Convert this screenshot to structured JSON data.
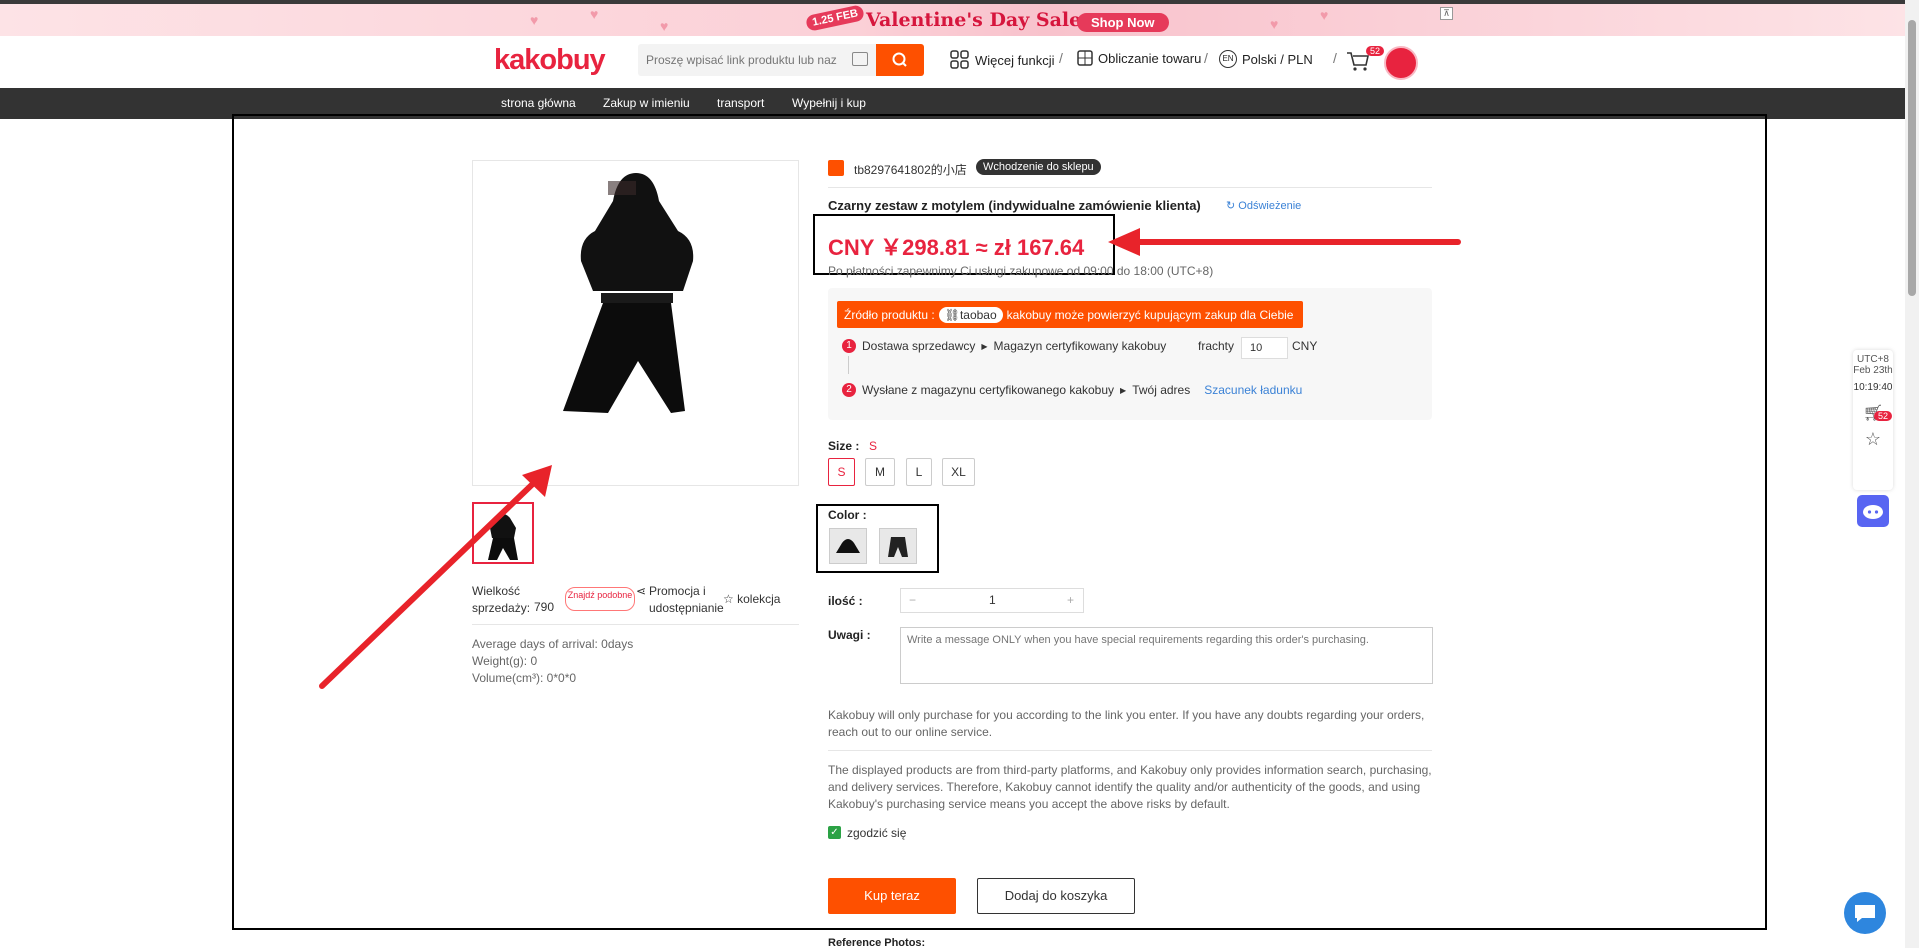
{
  "banner": {
    "date": "1.25 FEB",
    "title": "Valentine's Day Sale",
    "shop_now": "Shop Now"
  },
  "header": {
    "logo": "kakobuy",
    "search_placeholder": "Proszę wpisać link produktu lub naz",
    "more_functions": "Więcej funkcji",
    "calc": "Obliczanie towaru",
    "lang_badge": "EN",
    "lang": "Polski / PLN",
    "cart_count": "52"
  },
  "nav": {
    "items": [
      "strona główna",
      "Zakup w imieniu",
      "transport",
      "Wypełnij i kup"
    ]
  },
  "product": {
    "store_name": "tb8297641802的小店",
    "enter_store": "Wchodzenie do sklepu",
    "title": "Czarny zestaw z motylem (indywidualne zamówienie klienta)",
    "refresh": "Odświeżenie",
    "price": "CNY ￥298.81 ≈ zł 167.64",
    "after_payment": "Po płatności zapewnimy Ci usługi zakupowe od 09:00 do 18:00 (UTC+8)",
    "source_label": "Źródło produktu :",
    "source_platform": "taobao",
    "source_text": "kakobuy może powierzyć kupującym zakup dla Ciebie",
    "step1_num": "1",
    "step1_a": "Dostawa sprzedawcy",
    "step1_b": "Magazyn certyfikowany kakobuy",
    "freight_label": "frachty",
    "freight_value": "10",
    "freight_currency": "CNY",
    "step2_num": "2",
    "step2_a": "Wysłane z magazynu certyfikowanego kakobuy",
    "step2_b": "Twój adres",
    "shipping_estimate": "Szacunek ładunku",
    "size_label": "Size :",
    "size_selected": "S",
    "sizes": [
      "S",
      "M",
      "L",
      "XL"
    ],
    "color_label": "Color :",
    "qty_label": "ilość :",
    "qty_minus": "−",
    "qty_value": "1",
    "qty_plus": "+",
    "notes_label": "Uwagi :",
    "notes_placeholder": "Write a message ONLY when you have special requirements regarding this order's purchasing.",
    "notice1": "Kakobuy will only purchase for you according to the link you enter. If you have any doubts regarding your orders, reach out to our online service.",
    "notice2": "The displayed products are from third-party platforms, and Kakobuy only provides information search, purchasing, and delivery services. Therefore, Kakobuy cannot identify the quality and/or authenticity of the goods, and using Kakobuy's purchasing service means you accept the above risks by default.",
    "agree": "zgodzić się",
    "agree_check": "✓",
    "buy_now": "Kup teraz",
    "add_to_cart": "Dodaj do koszyka",
    "reference_photos": "Reference Photos:"
  },
  "left": {
    "sales_label": "Wielkość sprzedaży:",
    "sales_value": "790",
    "find_similar": "Znajdź podobne",
    "promo_share": "Promocja i udostępnianie",
    "collection": "kolekcja",
    "arrival": "Average days of arrival:  0days",
    "weight": "Weight(g):  0",
    "volume": "Volume(cm³):  0*0*0"
  },
  "sidebar": {
    "tz": "UTC+8",
    "date": "Feb 23th",
    "time": "10:19:40",
    "cart_count": "52"
  },
  "colors": {
    "accent": "#fe5000",
    "brand_red": "#e8233f",
    "annotation": "#e8232a"
  }
}
